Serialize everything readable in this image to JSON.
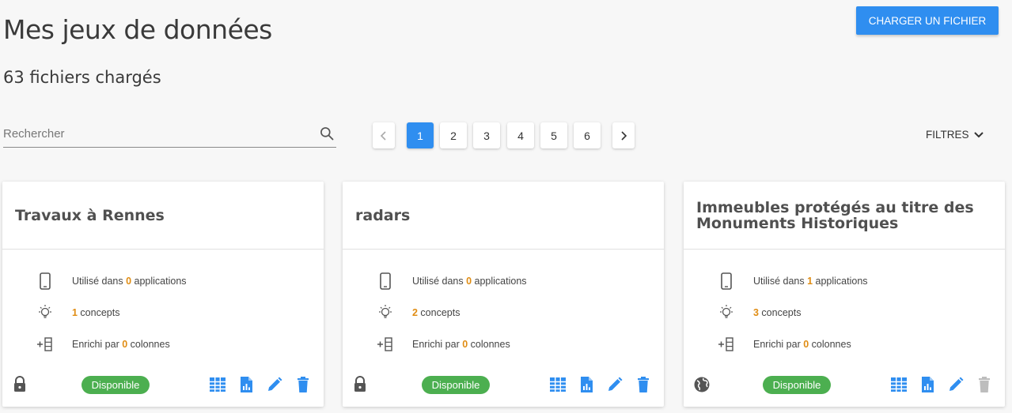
{
  "header": {
    "title": "Mes jeux de données",
    "file_count": "63 fichiers chargés",
    "upload_label": "CHARGER UN FICHIER"
  },
  "search": {
    "placeholder": "Rechercher",
    "value": ""
  },
  "pagination": {
    "pages": [
      "1",
      "2",
      "3",
      "4",
      "5",
      "6"
    ],
    "active": "1"
  },
  "filters": {
    "label": "FILTRES"
  },
  "colors": {
    "accent": "#2f8ef0",
    "available": "#4caf50",
    "highlight": "#e08d14"
  },
  "cards": [
    {
      "title": "Travaux à Rennes",
      "visibility_icon": "lock-icon",
      "apps_prefix": "Utilisé dans ",
      "apps_count": "0",
      "apps_suffix": " applications",
      "concepts_count": "1",
      "concepts_suffix": " concepts",
      "columns_prefix": "Enrichi par ",
      "columns_count": "0",
      "columns_suffix": " colonnes",
      "status": "Disponible",
      "delete_enabled": true
    },
    {
      "title": "radars",
      "visibility_icon": "lock-icon",
      "apps_prefix": "Utilisé dans ",
      "apps_count": "0",
      "apps_suffix": " applications",
      "concepts_count": "2",
      "concepts_suffix": " concepts",
      "columns_prefix": "Enrichi par ",
      "columns_count": "0",
      "columns_suffix": " colonnes",
      "status": "Disponible",
      "delete_enabled": true
    },
    {
      "title": "Immeubles protégés au titre des Monuments Historiques",
      "visibility_icon": "globe-icon",
      "apps_prefix": "Utilisé dans ",
      "apps_count": "1",
      "apps_suffix": " applications",
      "concepts_count": "3",
      "concepts_suffix": " concepts",
      "columns_prefix": "Enrichi par ",
      "columns_count": "0",
      "columns_suffix": " colonnes",
      "status": "Disponible",
      "delete_enabled": false
    }
  ]
}
